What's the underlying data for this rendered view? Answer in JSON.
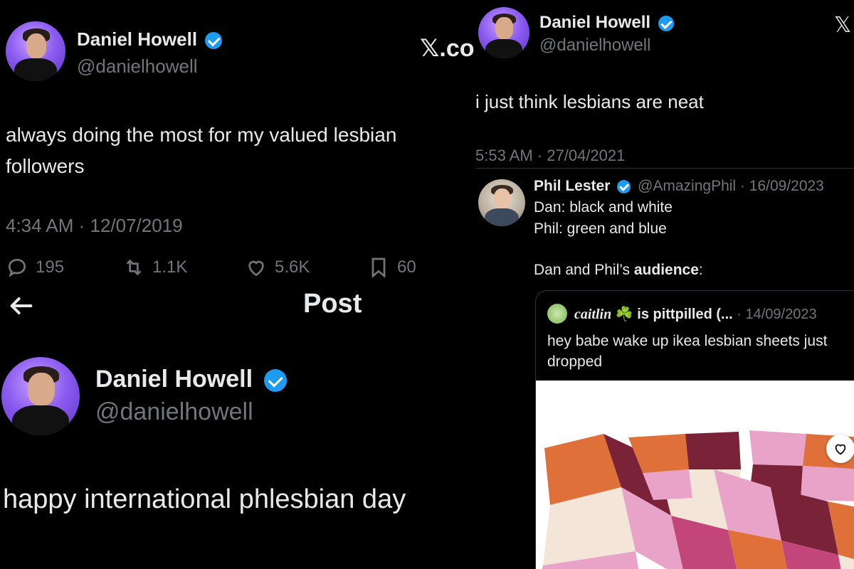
{
  "tweet_top_left": {
    "name": "Daniel Howell",
    "handle": "@danielhowell",
    "text": "always doing the most for my valued lesbian followers",
    "timestamp": "4:34 AM · 12/07/2019",
    "replies": "195",
    "reposts": "1.1K",
    "likes": "5.6K",
    "bookmarks": "60"
  },
  "post_header": {
    "title": "Post"
  },
  "tweet_bottom_left": {
    "name": "Daniel Howell",
    "handle": "@danielhowell",
    "text": "happy international phlesbian day"
  },
  "x_watermark_left": "𝕏.co",
  "x_watermark_right": "𝕏",
  "tweet_right": {
    "name": "Daniel Howell",
    "handle": "@danielhowell",
    "text": "i just think lesbians are neat",
    "timestamp": "5:53 AM · 27/04/2021"
  },
  "reply": {
    "name": "Phil Lester",
    "handle_date": "@AmazingPhil · 16/09/2023",
    "line1": "Dan: black and white",
    "line2": "Phil: green and blue",
    "line3_prefix": "Dan and Phil’s ",
    "line3_bold": "audience",
    "line3_suffix": ":"
  },
  "quote": {
    "name_italic": "caitlin",
    "name_emoji": "☘️",
    "name_rest": "is pittpilled (...",
    "date": "· 14/09/2023",
    "text": "hey babe wake up ikea lesbian sheets just dropped"
  },
  "colors": {
    "accent": "#1d9bf0",
    "muted": "#71767b",
    "sheet_maroon": "#7a2238",
    "sheet_orange": "#e0703a",
    "sheet_pink": "#e9a3c9",
    "sheet_cream": "#f3e6d8",
    "sheet_magenta": "#c2467a"
  }
}
